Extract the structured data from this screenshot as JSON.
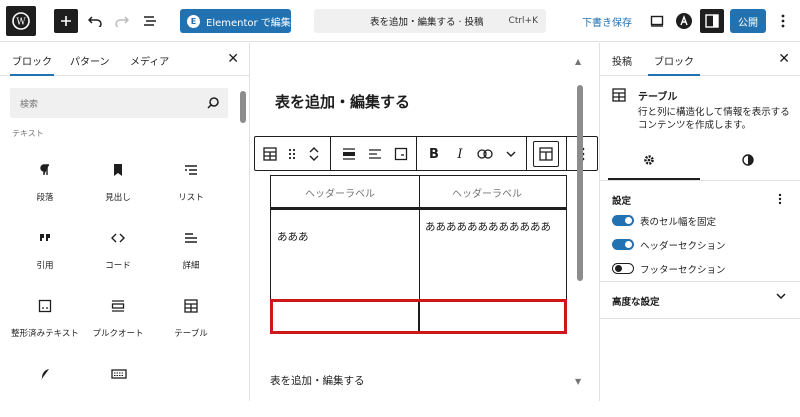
{
  "topbar": {
    "elementor_label": "Elementor で編集",
    "command_title": "表を追加・編集する · 投稿",
    "command_shortcut": "Ctrl+K",
    "draft_label": "下書き保存",
    "publish_label": "公開"
  },
  "inserter": {
    "tabs": [
      "ブロック",
      "パターン",
      "メディア"
    ],
    "search_placeholder": "検索",
    "category": "テキスト",
    "blocks": [
      {
        "label": "段落",
        "icon": "paragraph-icon"
      },
      {
        "label": "見出し",
        "icon": "heading-icon"
      },
      {
        "label": "リスト",
        "icon": "list-icon"
      },
      {
        "label": "引用",
        "icon": "quote-icon"
      },
      {
        "label": "コード",
        "icon": "code-icon"
      },
      {
        "label": "詳細",
        "icon": "details-icon"
      },
      {
        "label": "整形済みテキスト",
        "icon": "preformatted-icon"
      },
      {
        "label": "プルクオート",
        "icon": "pullquote-icon"
      },
      {
        "label": "テーブル",
        "icon": "table-icon"
      },
      {
        "label": "",
        "icon": "verse-icon"
      },
      {
        "label": "",
        "icon": "keyboard-icon"
      }
    ]
  },
  "editor": {
    "post_title": "表を追加・編集する",
    "table": {
      "headers": [
        "ヘッダーラベル",
        "ヘッダーラベル"
      ],
      "rows": [
        [
          "あああ",
          "ああああああああああああ"
        ],
        [
          "",
          ""
        ]
      ]
    },
    "caption": "表を追加・編集する"
  },
  "settings": {
    "tabs": [
      "投稿",
      "ブロック"
    ],
    "block_name": "テーブル",
    "block_desc": "行と列に構造化して情報を表示するコンテンツを作成します。",
    "section_title": "設定",
    "toggles": [
      {
        "label": "表のセル幅を固定",
        "on": true
      },
      {
        "label": "ヘッダーセクション",
        "on": true
      },
      {
        "label": "フッターセクション",
        "on": false
      }
    ],
    "advanced_label": "高度な設定"
  },
  "colors": {
    "accent": "#2271b1",
    "highlight": "#cc1818",
    "dark": "#1e1e1e"
  }
}
